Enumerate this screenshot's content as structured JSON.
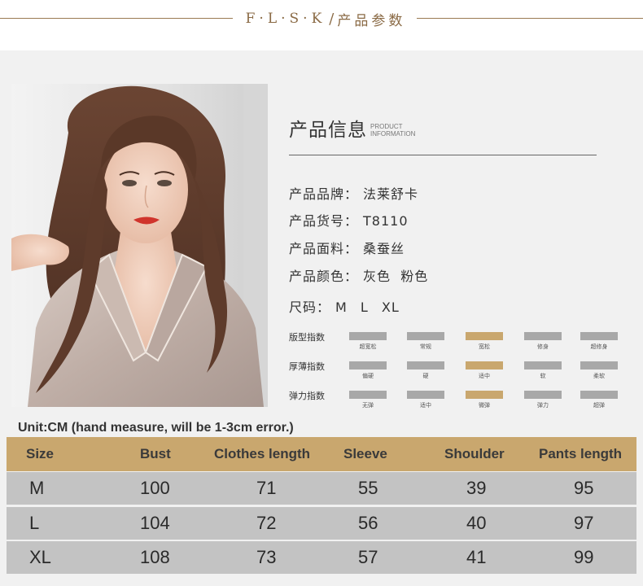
{
  "header": {
    "brand": "F·L·S·K",
    "separator": "/",
    "title": "产品参数"
  },
  "product_info": {
    "title_cn": "产品信息",
    "title_en_line1": "PRODUCT",
    "title_en_line2": "INFORMATION",
    "brand_label": "产品品牌：",
    "brand_value": "法莱舒卡",
    "item_no_label": "产品货号：",
    "item_no_value": "T8110",
    "fabric_label": "产品面料：",
    "fabric_value": "桑蚕丝",
    "color_label": "产品颜色：",
    "color_value": "灰色  粉色",
    "size_label": "尺码：",
    "size_value": "M L XL"
  },
  "indices": [
    {
      "label": "版型指数",
      "options": [
        "超宽松",
        "常规",
        "宽松",
        "修身",
        "超修身"
      ],
      "selected": 2
    },
    {
      "label": "厚薄指数",
      "options": [
        "偏硬",
        "硬",
        "适中",
        "软",
        "柔软"
      ],
      "selected": 2
    },
    {
      "label": "弹力指数",
      "options": [
        "无弹",
        "适中",
        "微弹",
        "弹力",
        "超弹"
      ],
      "selected": 2
    }
  ],
  "unit_note": "Unit:CM (hand measure, will be 1-3cm error.)",
  "size_table": {
    "headers": [
      "Size",
      "Bust",
      "Clothes length",
      "Sleeve",
      "Shoulder",
      "Pants length"
    ],
    "rows": [
      [
        "M",
        "100",
        "71",
        "55",
        "39",
        "95"
      ],
      [
        "L",
        "104",
        "72",
        "56",
        "40",
        "97"
      ],
      [
        "XL",
        "108",
        "73",
        "57",
        "41",
        "99"
      ]
    ]
  },
  "colors": {
    "accent_gold": "#c9a76e",
    "bar_gray": "#a8a8a8",
    "row_gray": "#c3c3c3",
    "header_line": "#9a7a52"
  }
}
